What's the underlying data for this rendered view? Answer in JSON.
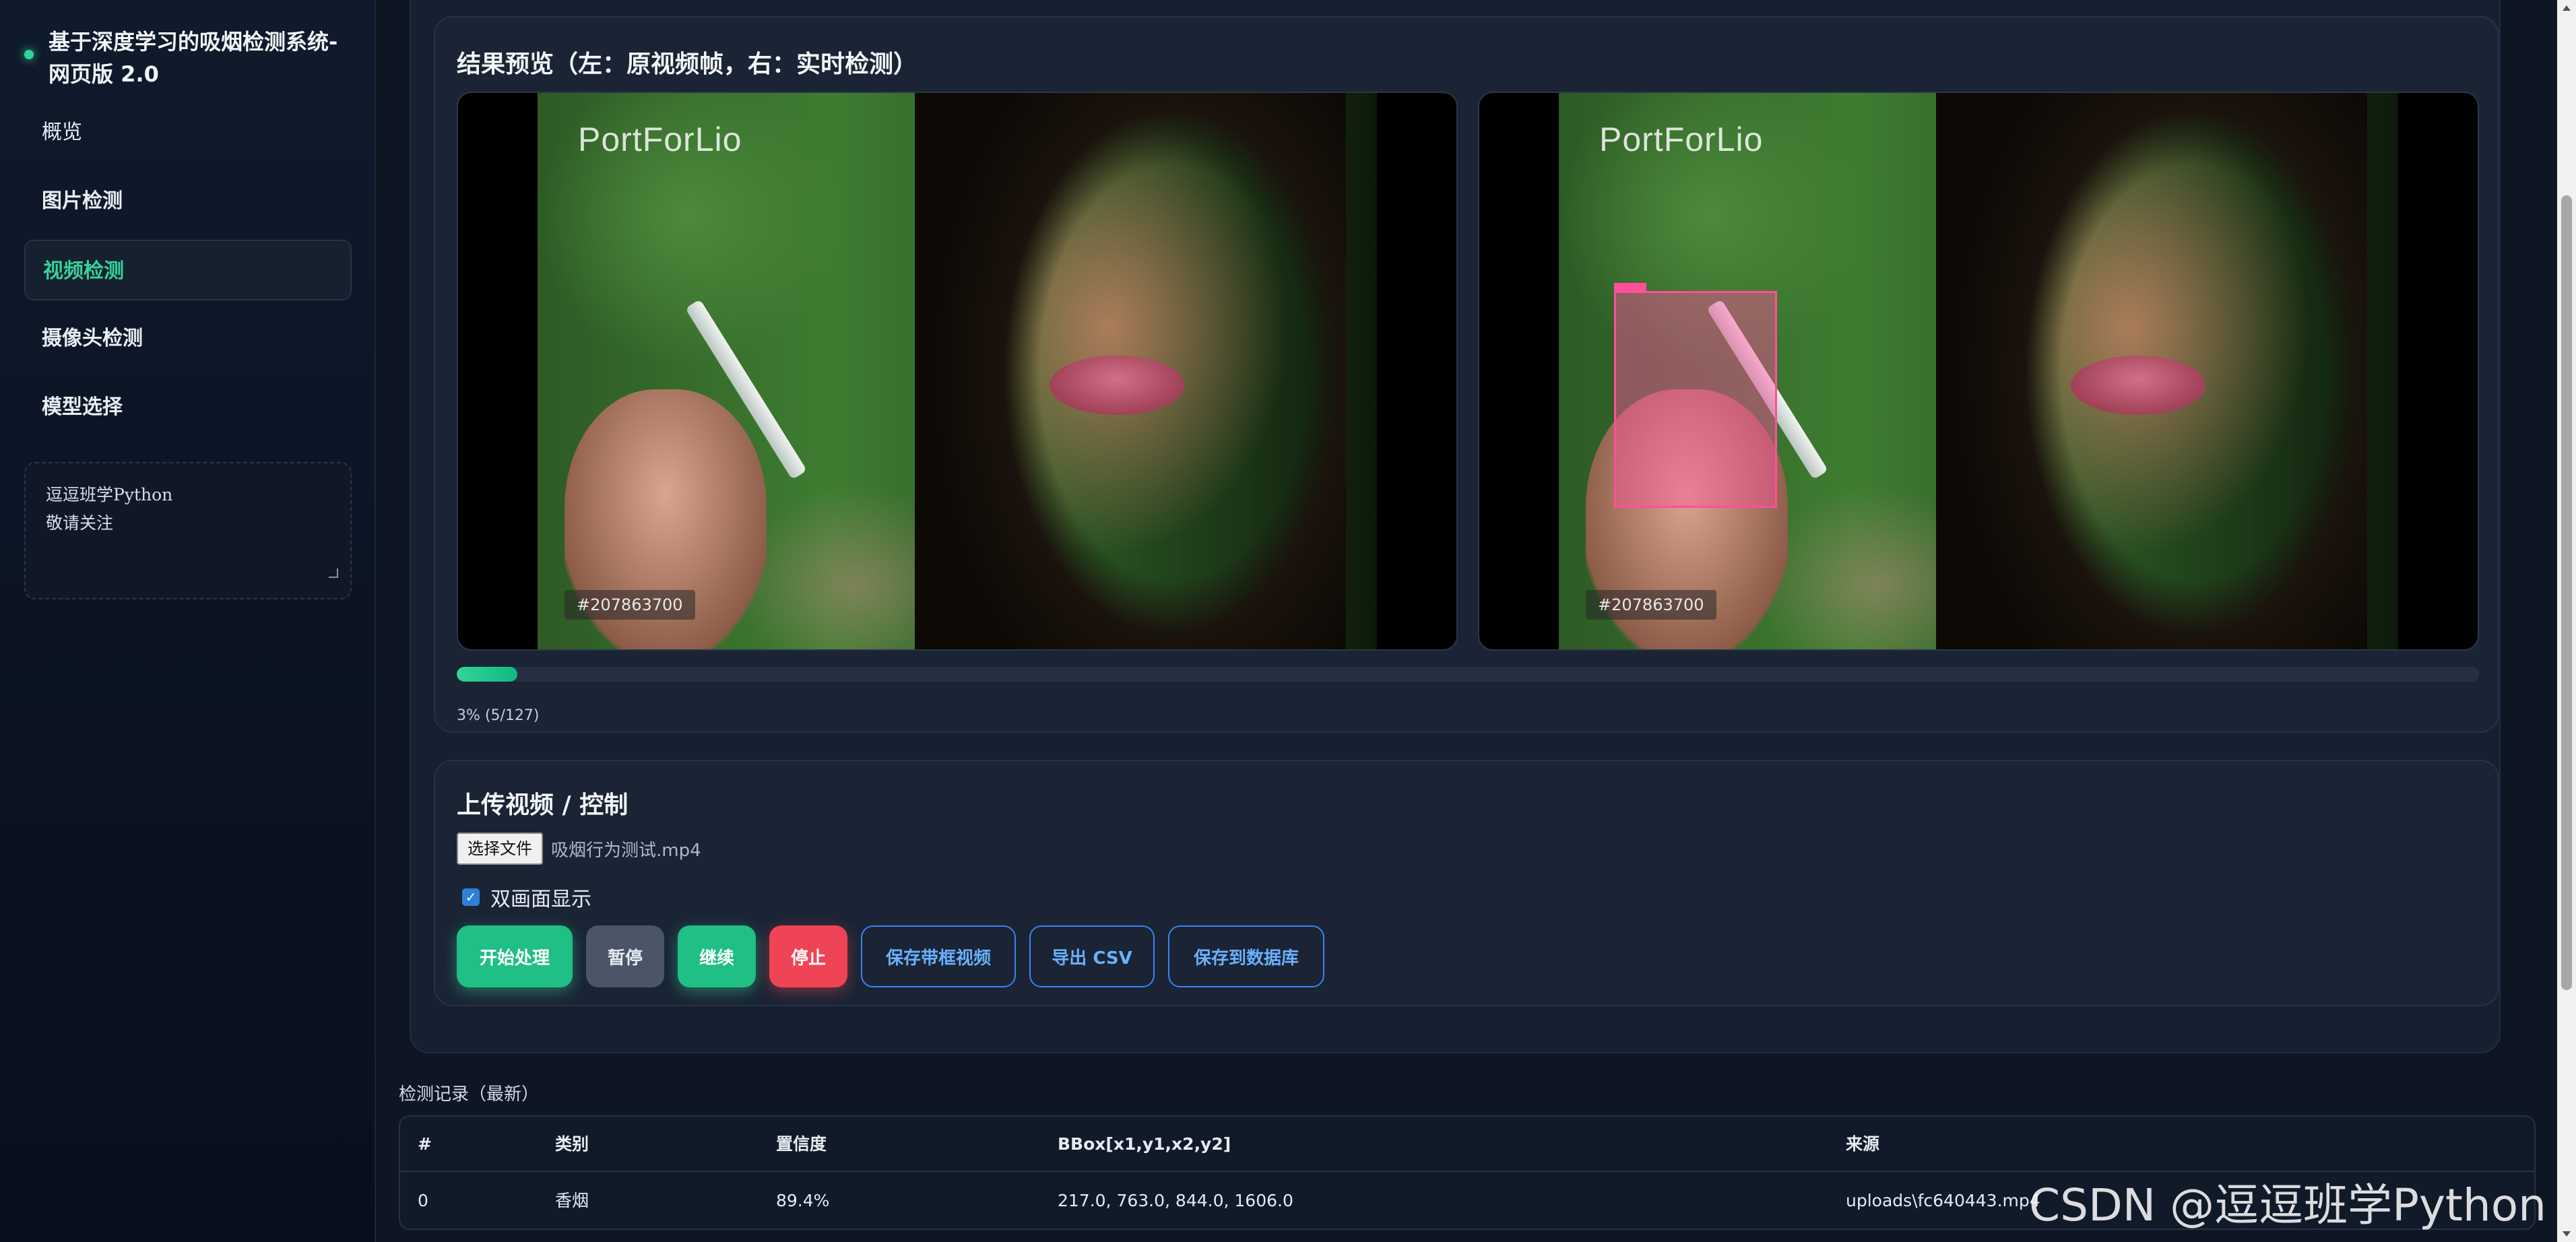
{
  "app": {
    "title": "基于深度学习的吸烟检测系统-网页版 2.0"
  },
  "sidebar": {
    "items": [
      {
        "label": "概览",
        "active": false
      },
      {
        "label": "图片检测",
        "active": false
      },
      {
        "label": "视频检测",
        "active": true
      },
      {
        "label": "摄像头检测",
        "active": false
      },
      {
        "label": "模型选择",
        "active": false
      }
    ],
    "note_lines": [
      "逗逗班学Python",
      "敬请关注"
    ]
  },
  "preview": {
    "title": "结果预览（左：原视频帧，右：实时检测）",
    "watermark": "PortForLio",
    "photo_id": "#207863700",
    "progress_fraction": 0.03,
    "progress_text": "3% (5/127)"
  },
  "upload": {
    "title": "上传视频 / 控制",
    "file_button": "选择文件",
    "file_name": "吸烟行为测试.mp4",
    "dual_view_label": "双画面显示",
    "dual_view_checked": true,
    "buttons": {
      "start": "开始处理",
      "pause": "暂停",
      "resume": "继续",
      "stop": "停止",
      "save_video": "保存带框视频",
      "export_csv": "导出 CSV",
      "save_db": "保存到数据库"
    }
  },
  "records": {
    "title": "检测记录（最新）",
    "headers": [
      "#",
      "类别",
      "置信度",
      "BBox[x1,y1,x2,y2]",
      "来源"
    ],
    "rows": [
      [
        "0",
        "香烟",
        "89.4%",
        "217.0, 763.0, 844.0, 1606.0",
        "uploads\\fc640443.mp4"
      ]
    ]
  },
  "watermark_overlay": "CSDN @逗逗班学Python",
  "colors": {
    "accent": "#34d399",
    "danger": "#ef4455",
    "outline": "#3b82f6",
    "detection_box": "#ff4f9a"
  },
  "icons": {
    "checkbox": "checkmark-icon",
    "brand": "status-dot-icon"
  }
}
